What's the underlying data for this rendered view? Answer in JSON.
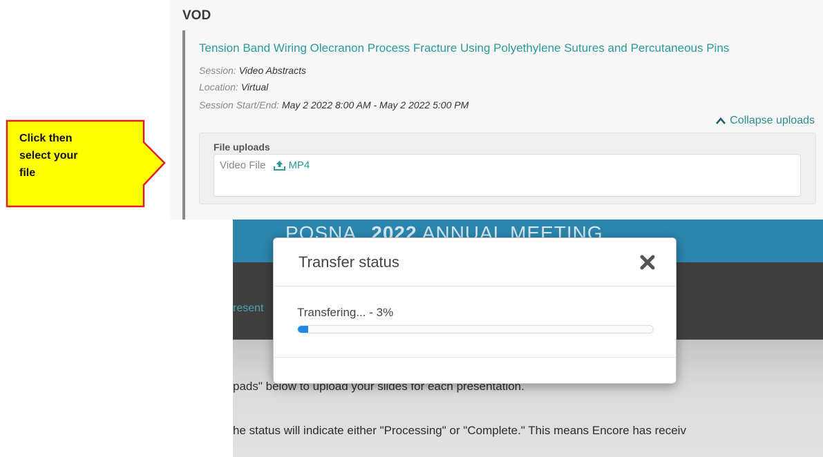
{
  "vod": {
    "section_title": "VOD",
    "presentation_title": "Tension Band Wiring Olecranon Process Fracture Using Polyethylene Sutures and Percutaneous Pins",
    "session_label": "Session:",
    "session_value": "Video Abstracts",
    "location_label": "Location:",
    "location_value": "Virtual",
    "start_end_label": "Session Start/End:",
    "start_end_value": "May 2 2022 8:00 AM - May 2 2022 5:00 PM",
    "collapse_label": "Collapse uploads",
    "file_uploads_heading": "File uploads",
    "video_file_label": "Video File",
    "mp4_link": "MP4"
  },
  "callout": {
    "line1": "Click then",
    "line2": "select your",
    "line3": "file"
  },
  "background": {
    "banner_logo": "POSNA",
    "banner_year": "2022",
    "banner_text": "ANNUAL MEETING",
    "tab_fragment": "resent",
    "line1": "pads\" below to upload your slides for each presentation.",
    "line2": "he status will indicate either \"Processing\" or \"Complete.\" This means Encore has receiv"
  },
  "modal": {
    "title": "Transfer status",
    "status_text": "Transfering... - 3%",
    "progress_percent": 3
  },
  "colors": {
    "link_teal": "#2a9a9a",
    "progress_blue": "#1e88e5",
    "callout_yellow": "#ffff00",
    "callout_border": "#e02020",
    "banner_blue": "#2b86ad"
  }
}
